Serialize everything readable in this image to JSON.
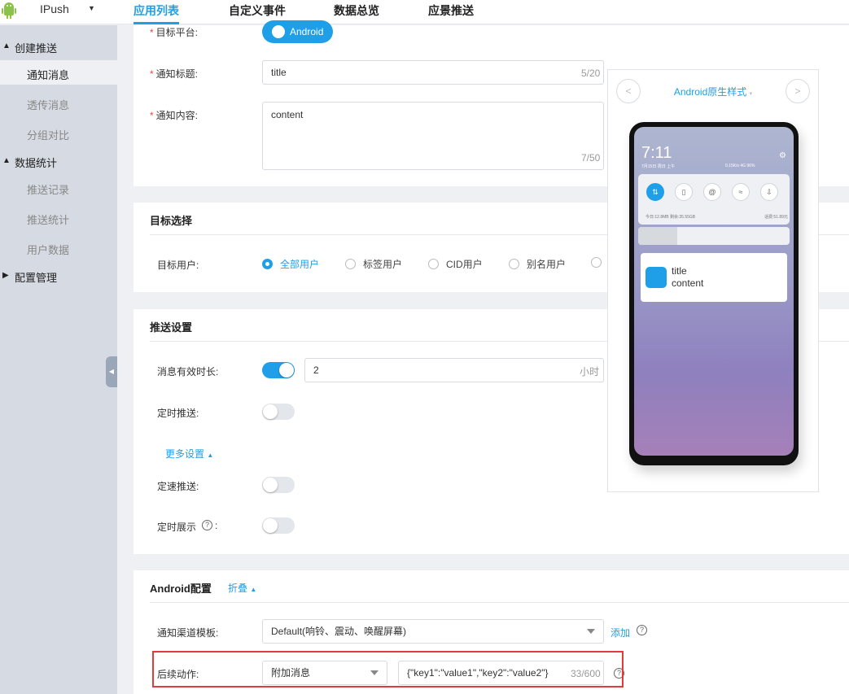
{
  "header": {
    "app_name": "IPush",
    "nav": [
      "应用列表",
      "自定义事件",
      "数据总览",
      "应景推送"
    ]
  },
  "sidebar": {
    "groups": [
      {
        "label": "创建推送",
        "items": [
          "通知消息",
          "透传消息",
          "分组对比"
        ]
      },
      {
        "label": "数据统计",
        "items": [
          "推送记录",
          "推送统计",
          "用户数据"
        ]
      },
      {
        "label": "配置管理",
        "items": []
      }
    ],
    "active_item": "通知消息"
  },
  "form": {
    "platform_label": "目标平台:",
    "platform_button": "Android",
    "title_label": "通知标题:",
    "title_value": "title",
    "title_count": "5/20",
    "content_label": "通知内容:",
    "content_value": "content",
    "content_count": "7/50"
  },
  "target": {
    "section_title": "目标选择",
    "users_label": "目标用户:",
    "options": [
      "全部用户",
      "标签用户",
      "CID用户",
      "别名用户"
    ],
    "selected": "全部用户"
  },
  "push_settings": {
    "section_title": "推送设置",
    "ttl_label": "消息有效时长:",
    "ttl_value": "2",
    "ttl_unit": "小时",
    "scheduled_label": "定时推送:",
    "more_link": "更多设置",
    "rate_label": "定速推送:",
    "timed_display_label": "定时展示",
    "timed_display_suffix": ":"
  },
  "android": {
    "section_title": "Android配置",
    "collapse_link": "折叠",
    "channel_label": "通知渠道模板:",
    "channel_value": "Default(响铃、震动、唤醒屏幕)",
    "add_link": "添加",
    "action_label": "后续动作:",
    "action_value": "附加消息",
    "extra_value": "{\"key1\":\"value1\",\"key2\":\"value2\"}",
    "extra_count": "33/600"
  },
  "preview": {
    "title": "Android原生样式",
    "time": "7:11",
    "date": "7月15日 周日 上午",
    "status": "0.15K/s 4G 96%",
    "data_left": "今日:12.8MB   剩余:35.55GB",
    "data_right": "话费:51.89元",
    "notif_title": "title",
    "notif_content": "content"
  },
  "colors": {
    "accent": "#1e9fe8",
    "highlight": "#e23b3b"
  }
}
